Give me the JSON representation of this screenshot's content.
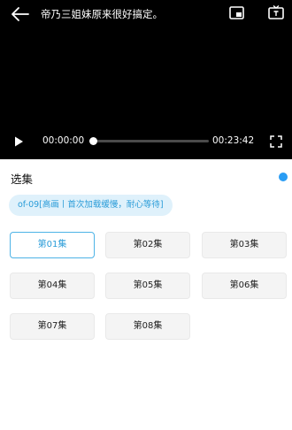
{
  "player": {
    "title": "帝乃三姐妹原来很好搞定。",
    "current_time": "00:00:00",
    "total_time": "00:23:42",
    "progress_fraction": 0
  },
  "panel": {
    "title": "选集",
    "source_label": "of-09[高画丨首次加载缓慢，耐心等待]",
    "accent_color": "#2a9df4",
    "episodes": [
      {
        "label": "第01集",
        "active": true
      },
      {
        "label": "第02集",
        "active": false
      },
      {
        "label": "第03集",
        "active": false
      },
      {
        "label": "第04集",
        "active": false
      },
      {
        "label": "第05集",
        "active": false
      },
      {
        "label": "第06集",
        "active": false
      },
      {
        "label": "第07集",
        "active": false
      },
      {
        "label": "第08集",
        "active": false
      }
    ]
  }
}
